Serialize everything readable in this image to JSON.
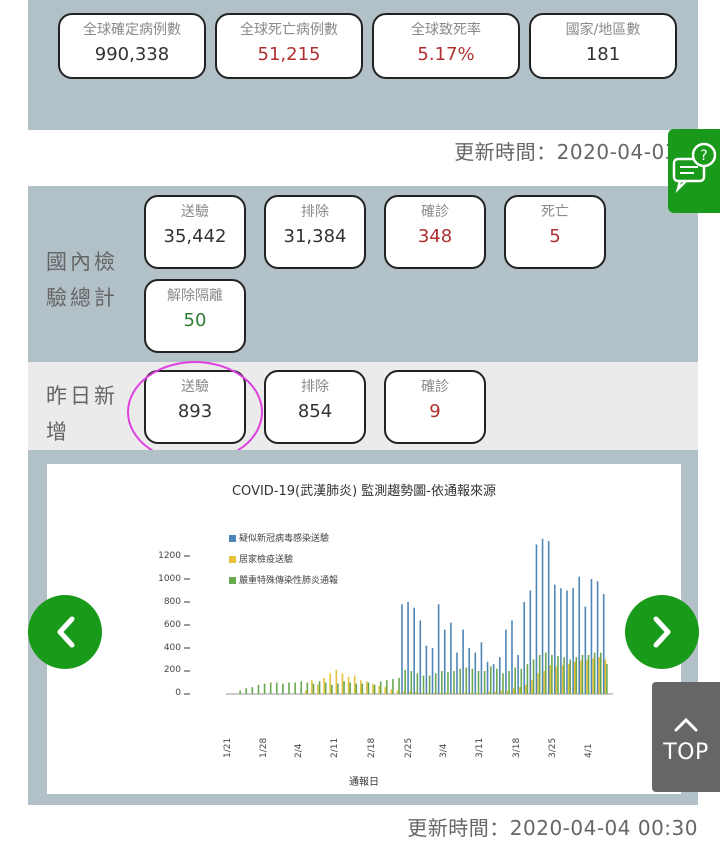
{
  "global": {
    "cards": [
      {
        "label": "全球確定病例數",
        "value": "990,338",
        "tone": "dark"
      },
      {
        "label": "全球死亡病例數",
        "value": "51,215",
        "tone": "red"
      },
      {
        "label": "全球致死率",
        "value": "5.17%",
        "tone": "red"
      },
      {
        "label": "國家/地區數",
        "value": "181",
        "tone": "dark"
      }
    ],
    "update_time": "更新時間：2020-04-03 0"
  },
  "domestic": {
    "row_label": "國內檢驗總計",
    "row_label_lines": [
      "國內檢",
      "驗總計"
    ],
    "cards": [
      {
        "label": "送驗",
        "value": "35,442",
        "tone": "dark"
      },
      {
        "label": "排除",
        "value": "31,384",
        "tone": "dark"
      },
      {
        "label": "確診",
        "value": "348",
        "tone": "red"
      },
      {
        "label": "死亡",
        "value": "5",
        "tone": "red"
      },
      {
        "label": "解除隔離",
        "value": "50",
        "tone": "green"
      }
    ]
  },
  "yesterday": {
    "row_label_lines": [
      "昨日新",
      "增"
    ],
    "cards": [
      {
        "label": "送驗",
        "value": "893",
        "tone": "dark"
      },
      {
        "label": "排除",
        "value": "854",
        "tone": "dark"
      },
      {
        "label": "確診",
        "value": "9",
        "tone": "red"
      }
    ]
  },
  "chart_data": {
    "type": "bar",
    "title": "COVID-19(武漢肺炎) 監測趨勢圖-依通報來源",
    "xlabel": "通報日",
    "ylabel": "",
    "ylim": [
      0,
      1400
    ],
    "yticks": [
      0,
      200,
      400,
      600,
      800,
      1000,
      1200
    ],
    "xtick_labels": [
      "1/21",
      "1/28",
      "2/4",
      "2/11",
      "2/18",
      "2/25",
      "3/4",
      "3/11",
      "3/18",
      "3/25",
      "4/1"
    ],
    "legend": [
      "疑似新冠病毒感染送驗",
      "居家檢疫送驗",
      "嚴重特殊傳染性肺炎通報"
    ],
    "colors": [
      "#4f86b8",
      "#e6c23a",
      "#6aa84f"
    ],
    "series": [
      {
        "name": "疑似新冠病毒感染送驗",
        "values": [
          0,
          0,
          0,
          0,
          0,
          0,
          0,
          0,
          0,
          0,
          0,
          0,
          0,
          0,
          0,
          0,
          0,
          0,
          0,
          0,
          0,
          0,
          0,
          0,
          0,
          0,
          0,
          0,
          780,
          800,
          750,
          640,
          420,
          400,
          780,
          560,
          620,
          360,
          560,
          400,
          360,
          450,
          280,
          260,
          320,
          560,
          640,
          340,
          800,
          900,
          1300,
          1350,
          1330,
          950,
          920,
          900,
          920,
          1020,
          760,
          1000,
          980,
          870
        ]
      },
      {
        "name": "居家檢疫送驗",
        "values": [
          0,
          0,
          0,
          0,
          0,
          0,
          0,
          0,
          0,
          0,
          0,
          0,
          30,
          120,
          80,
          140,
          180,
          210,
          180,
          150,
          160,
          120,
          110,
          90,
          70,
          60,
          40,
          30,
          20,
          20,
          15,
          10,
          10,
          10,
          10,
          10,
          10,
          10,
          10,
          10,
          10,
          10,
          20,
          20,
          30,
          30,
          50,
          60,
          80,
          120,
          180,
          200,
          250,
          240,
          250,
          260,
          280,
          290,
          300,
          310,
          320,
          300
        ]
      },
      {
        "name": "嚴重特殊傳染性肺炎通報",
        "values": [
          0,
          30,
          50,
          60,
          80,
          90,
          100,
          100,
          90,
          100,
          100,
          110,
          100,
          90,
          110,
          100,
          80,
          90,
          110,
          100,
          90,
          90,
          100,
          80,
          110,
          120,
          130,
          140,
          210,
          200,
          180,
          160,
          160,
          180,
          200,
          190,
          200,
          220,
          230,
          220,
          200,
          200,
          240,
          220,
          180,
          200,
          230,
          220,
          260,
          300,
          340,
          360,
          340,
          330,
          320,
          300,
          320,
          340,
          340,
          360,
          360,
          260
        ]
      }
    ]
  }
}
